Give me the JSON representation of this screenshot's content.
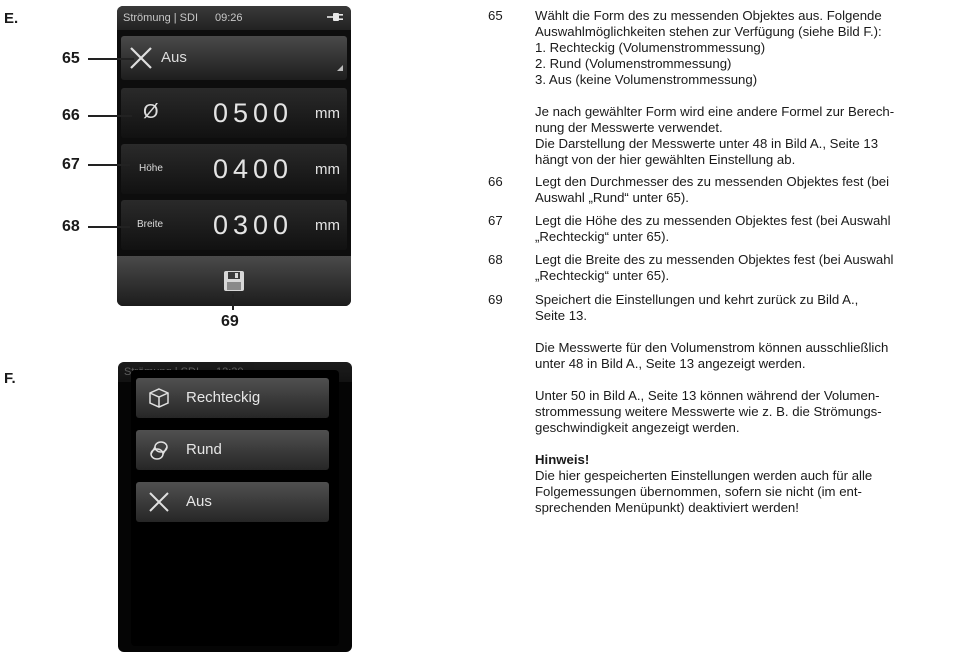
{
  "figure_e": {
    "letter": "E.",
    "statusbar": {
      "title": "Strömung | SDI",
      "time": "09:26"
    },
    "shape_row": {
      "label": "Aus",
      "icon": "x-icon"
    },
    "diameter_row": {
      "label": "Ø",
      "value": "0500",
      "unit": "mm"
    },
    "height_row": {
      "label": "Höhe",
      "value": "0400",
      "unit": "mm"
    },
    "width_row": {
      "label": "Breite",
      "value": "0300",
      "unit": "mm"
    },
    "save_icon": "save-icon",
    "callouts": [
      "65",
      "66",
      "67",
      "68",
      "69"
    ]
  },
  "figure_f": {
    "letter": "F.",
    "statusbar": {
      "title": "Strömung | SDI",
      "time": "12:30"
    },
    "options": [
      {
        "label": "Rechteckig",
        "icon": "cube-icon"
      },
      {
        "label": "Rund",
        "icon": "cylinder-icon"
      },
      {
        "label": "Aus",
        "icon": "x-icon"
      }
    ]
  },
  "description": {
    "items": [
      {
        "number": "65",
        "lines": [
          "Wählt die Form des zu messenden Objektes aus. Folgende",
          "Auswahlmöglichkeiten stehen zur Verfügung (siehe Bild F.):",
          "1.  Rechteckig (Volumenstrommessung)",
          "2.  Rund (Volumenstrommessung)",
          "3.  Aus (keine Volumenstrommessung)",
          "",
          "Je nach gewählter Form wird eine andere Formel zur Berech-",
          "nung der Messwerte verwendet.",
          "Die Darstellung der Messwerte unter 48 in Bild A., Seite 13",
          "hängt von der hier gewählten Einstellung ab."
        ]
      },
      {
        "number": "66",
        "lines": [
          "Legt den Durchmesser des zu messenden Objektes fest (bei",
          "Auswahl „Rund“ unter 65)."
        ]
      },
      {
        "number": "67",
        "lines": [
          "Legt die Höhe des zu messenden Objektes fest (bei Auswahl",
          "„Rechteckig“ unter 65)."
        ]
      },
      {
        "number": "68",
        "lines": [
          "Legt die Breite des zu messenden Objektes fest (bei Auswahl",
          "„Rechteckig“ unter 65)."
        ]
      },
      {
        "number": "69",
        "lines": [
          "Speichert die Einstellungen und kehrt zurück zu Bild A.,",
          "Seite 13.",
          "",
          "Die Messwerte für den Volumenstrom können ausschließlich",
          "unter 48 in Bild A., Seite 13 angezeigt werden.",
          "",
          "Unter 50 in Bild A., Seite 13 können während der Volumen-",
          "strommessung weitere Messwerte wie z. B. die Strömungs-",
          "geschwindigkeit angezeigt werden.",
          "",
          "Hinweis!",
          "Die hier gespeicherten Einstellungen werden auch für alle",
          "Folgemessungen übernommen, sofern sie nicht (im ent-",
          "sprechenden Menüpunkt) deaktiviert werden!"
        ]
      }
    ]
  }
}
